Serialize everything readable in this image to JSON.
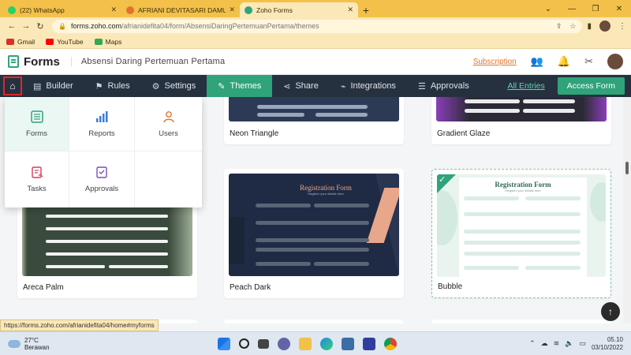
{
  "browser": {
    "tabs": [
      {
        "title": "(22) WhatsApp",
        "color": "#25D366"
      },
      {
        "title": "AFRIANI DEVITASARI DAMULAWAN",
        "color": "#e0732f"
      },
      {
        "title": "Zoho Forms",
        "color": "#2fa37a"
      }
    ],
    "url_domain": "forms.zoho.com",
    "url_path": "/afrianidefita04/form/AbsensiDaringPertemuanPertama/themes",
    "bookmarks": [
      {
        "label": "Gmail",
        "color": "#d93025"
      },
      {
        "label": "YouTube",
        "color": "#ff0000"
      },
      {
        "label": "Maps",
        "color": "#34a853"
      }
    ]
  },
  "header": {
    "brand": "Forms",
    "form_title": "Absensi Daring Pertemuan Pertama",
    "subscription": "Subscription"
  },
  "navbar": {
    "items": [
      {
        "label": "Builder",
        "icon": "builder-icon",
        "glyph": "▤"
      },
      {
        "label": "Rules",
        "icon": "rules-icon",
        "glyph": "⚑"
      },
      {
        "label": "Settings",
        "icon": "settings-icon",
        "glyph": "⚙"
      },
      {
        "label": "Themes",
        "icon": "themes-icon",
        "glyph": "✎"
      },
      {
        "label": "Share",
        "icon": "share-icon",
        "glyph": "⋖"
      },
      {
        "label": "Integrations",
        "icon": "integrations-icon",
        "glyph": "⌁"
      },
      {
        "label": "Approvals",
        "icon": "approvals-icon",
        "glyph": "☰"
      }
    ],
    "active": "Themes",
    "all_entries": "All Entries",
    "access_form": "Access Form"
  },
  "dropdown": {
    "items": [
      {
        "label": "Forms",
        "icon": "forms-icon",
        "color": "#2fa37a"
      },
      {
        "label": "Reports",
        "icon": "reports-icon",
        "color": "#3b7dd8"
      },
      {
        "label": "Users",
        "icon": "users-icon",
        "color": "#e0732f"
      },
      {
        "label": "Tasks",
        "icon": "tasks-icon",
        "color": "#d83b5a"
      },
      {
        "label": "Approvals",
        "icon": "approvals-icon",
        "color": "#7a4fb5"
      }
    ]
  },
  "themes": {
    "cards": [
      {
        "label": "Neon Triangle"
      },
      {
        "label": "Gradient Glaze"
      },
      {
        "label": "Areca Palm"
      },
      {
        "label": "Peach Dark",
        "form_title": "Registration Form",
        "form_sub": "Register your details here"
      },
      {
        "label": "Bubble",
        "form_title": "Registration Form",
        "form_sub": "Register your details here"
      }
    ]
  },
  "status_link": "https://forms.zoho.com/afrianidefita04/home#myforms",
  "taskbar": {
    "temperature": "27°C",
    "weather": "Berawan",
    "time": "05.10",
    "date": "03/10/2022"
  }
}
